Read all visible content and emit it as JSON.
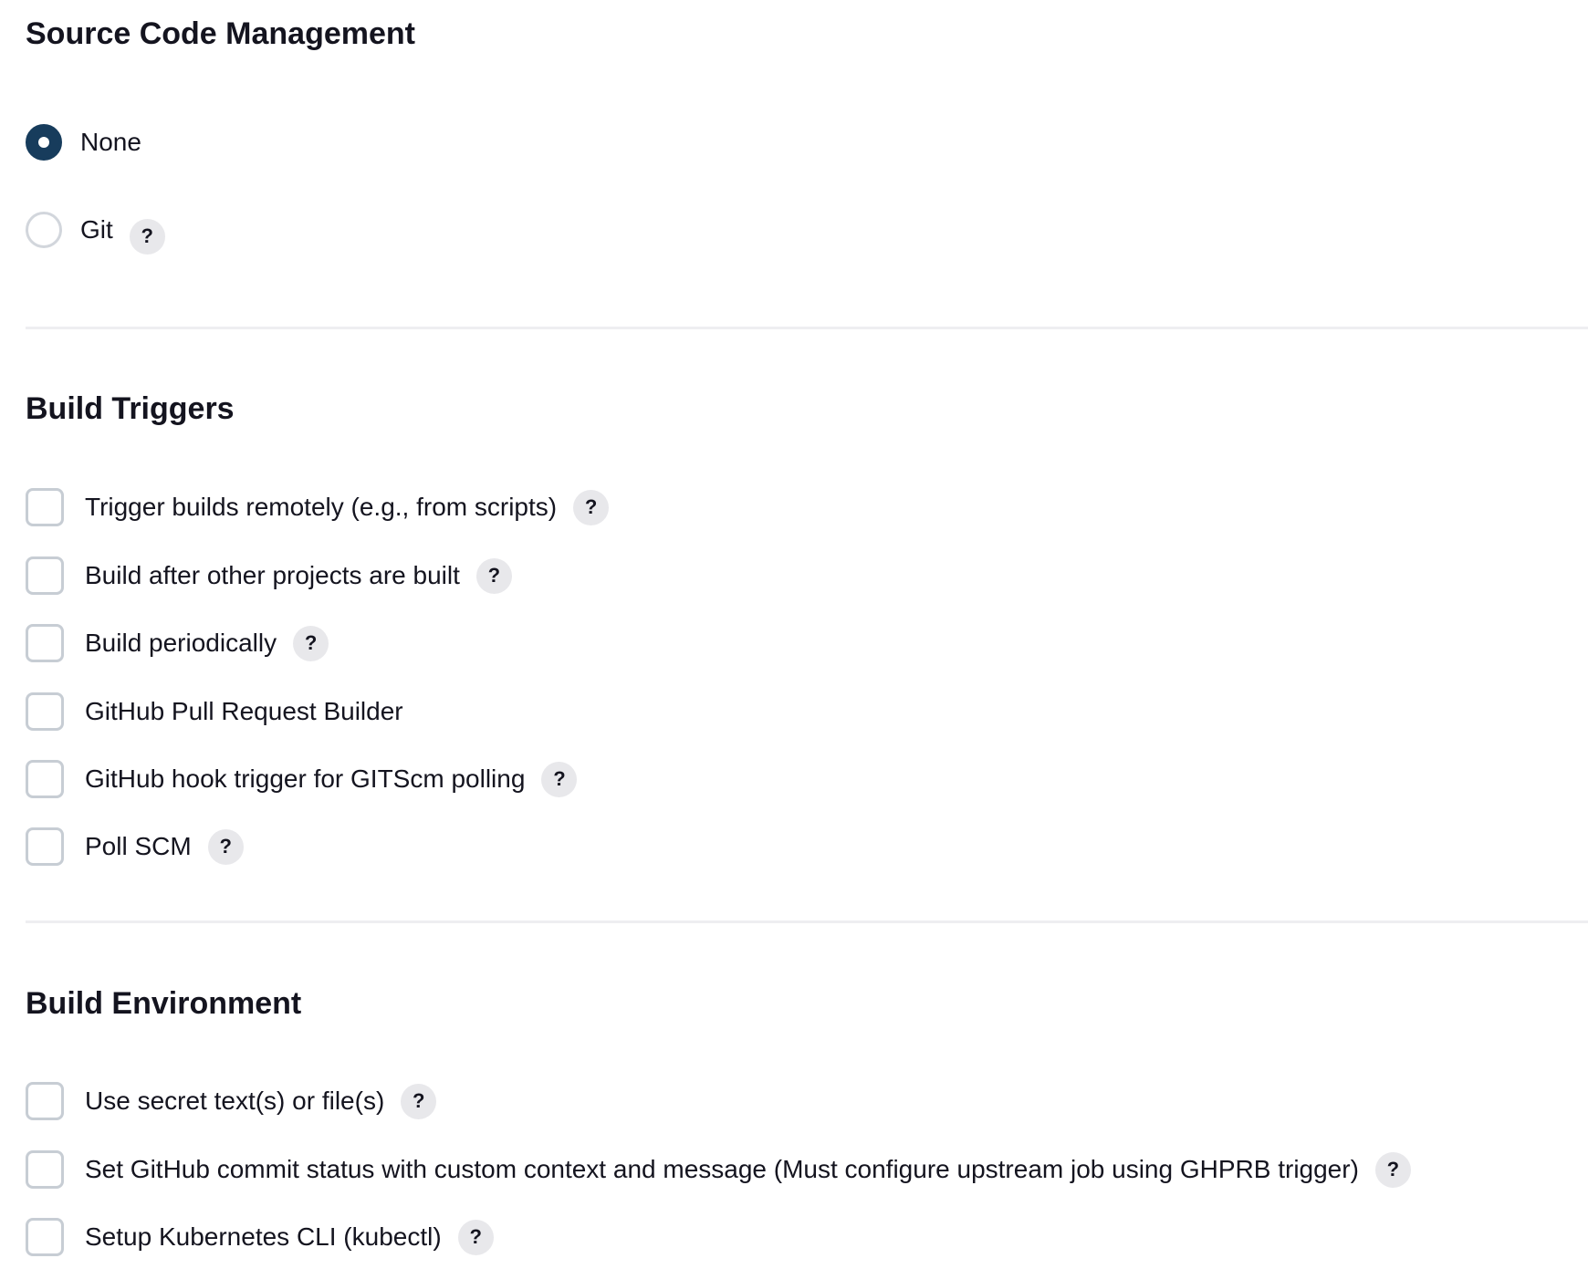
{
  "source_code_management": {
    "title": "Source Code Management",
    "options": [
      {
        "label": "None",
        "selected": true,
        "help_icon": null
      },
      {
        "label": "Git",
        "selected": false,
        "help_icon": "?"
      }
    ]
  },
  "build_triggers": {
    "title": "Build Triggers",
    "options": [
      {
        "label": "Trigger builds remotely (e.g., from scripts)",
        "checked": false,
        "help_icon": "?"
      },
      {
        "label": "Build after other projects are built",
        "checked": false,
        "help_icon": "?"
      },
      {
        "label": "Build periodically",
        "checked": false,
        "help_icon": "?"
      },
      {
        "label": "GitHub Pull Request Builder",
        "checked": false,
        "help_icon": null
      },
      {
        "label": "GitHub hook trigger for GITScm polling",
        "checked": false,
        "help_icon": "?"
      },
      {
        "label": "Poll SCM",
        "checked": false,
        "help_icon": "?"
      }
    ]
  },
  "build_environment": {
    "title": "Build Environment",
    "options": [
      {
        "label": "Use secret text(s) or file(s)",
        "checked": false,
        "help_icon": "?"
      },
      {
        "label": "Set GitHub commit status with custom context and message (Must configure upstream job using GHPRB trigger)",
        "checked": false,
        "help_icon": "?"
      },
      {
        "label": "Setup Kubernetes CLI (kubectl)",
        "checked": false,
        "help_icon": "?"
      }
    ]
  },
  "colors": {
    "radio_selected": "#173c5c",
    "help_badge_bg": "#e8e8eb",
    "control_border": "#c7cdd4",
    "divider": "#eeeef1",
    "text": "#14141f"
  }
}
